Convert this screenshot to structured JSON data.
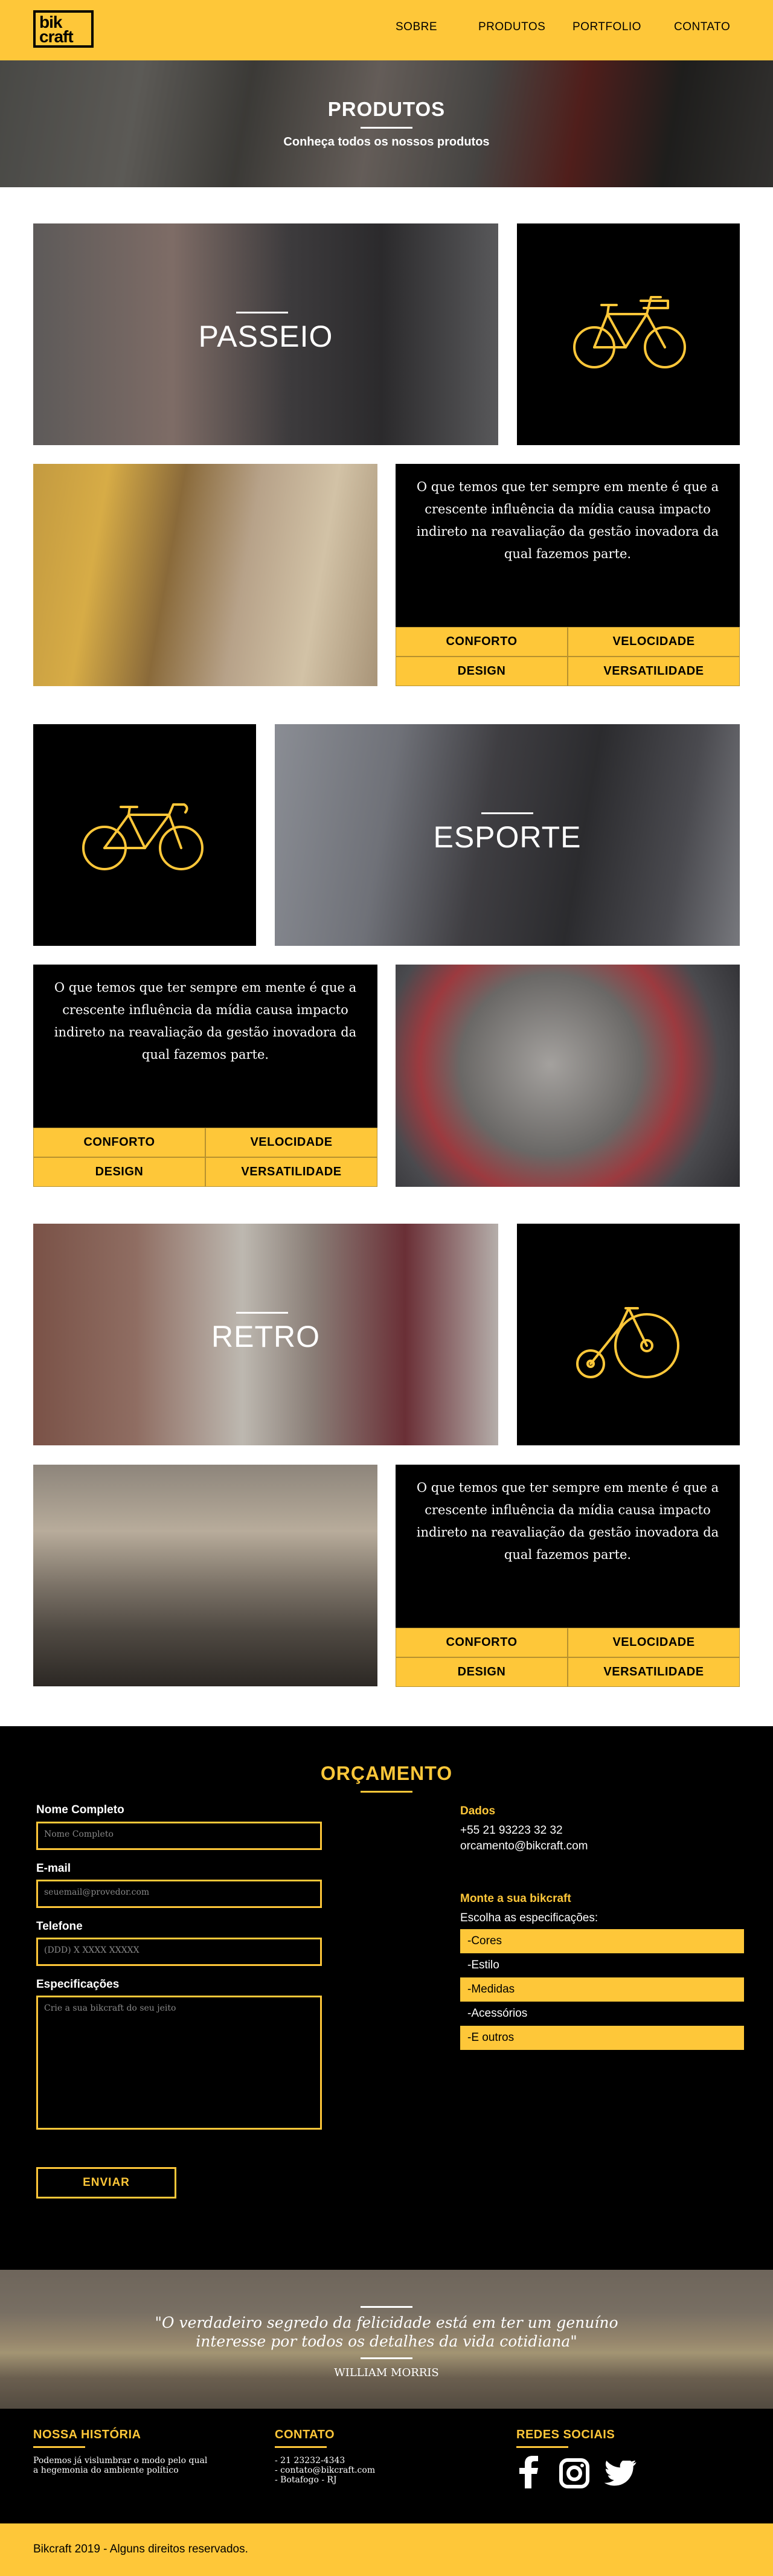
{
  "header": {
    "logo_line1": "bik",
    "logo_line2": "craft",
    "nav": [
      {
        "label": "SOBRE"
      },
      {
        "label": "PRODUTOS"
      },
      {
        "label": "PORTFOLIO"
      },
      {
        "label": "CONTATO"
      }
    ]
  },
  "hero": {
    "title": "PRODUTOS",
    "subtitle": "Conheça todos os nossos produtos"
  },
  "products": [
    {
      "name": "PASSEIO",
      "icon": "city-bicycle-icon",
      "description": "O que temos que ter sempre em mente é que a crescente influência da mídia causa impacto indireto na reavaliação da gestão inovadora da qual fazemos parte.",
      "features": [
        "CONFORTO",
        "VELOCIDADE",
        "DESIGN",
        "VERSATILIDADE"
      ]
    },
    {
      "name": "ESPORTE",
      "icon": "sport-bicycle-icon",
      "description": "O que temos que ter sempre em mente é que a crescente influência da mídia causa impacto indireto na reavaliação da gestão inovadora da qual fazemos parte.",
      "features": [
        "CONFORTO",
        "VELOCIDADE",
        "DESIGN",
        "VERSATILIDADE"
      ]
    },
    {
      "name": "RETRO",
      "icon": "penny-farthing-icon",
      "description": "O que temos que ter sempre em mente é que a crescente influência da mídia causa impacto indireto na reavaliação da gestão inovadora da qual fazemos parte.",
      "features": [
        "CONFORTO",
        "VELOCIDADE",
        "DESIGN",
        "VERSATILIDADE"
      ]
    }
  ],
  "orcamento": {
    "title": "ORÇAMENTO",
    "fields": {
      "name_label": "Nome Completo",
      "name_placeholder": "Nome Completo",
      "email_label": "E-mail",
      "email_placeholder": "seuemail@provedor.com",
      "phone_label": "Telefone",
      "phone_placeholder": "(DDD) X XXXX XXXXX",
      "spec_label": "Especificações",
      "spec_placeholder": "Crie a sua bikcraft do seu jeito",
      "submit": "ENVIAR"
    },
    "dados": {
      "title": "Dados",
      "phone": "+55 21 93223 32 32",
      "email": "orcamento@bikcraft.com"
    },
    "monte": {
      "title": "Monte a sua bikcraft",
      "intro": "Escolha as especificações:",
      "options": [
        "-Cores",
        "-Estilo",
        "-Medidas",
        "-Acessórios",
        "-E outros"
      ]
    }
  },
  "quote": {
    "line1": "\"O verdadeiro segredo da felicidade está em ter um genuíno",
    "line2": "interesse por todos os detalhes da vida cotidiana\"",
    "author": "WILLIAM MORRIS"
  },
  "footer": {
    "historia_title": "NOSSA HISTÓRIA",
    "historia_line1": "Podemos já vislumbrar o modo pelo qual",
    "historia_line2": "a hegemonia do ambiente político",
    "contato_title": "CONTATO",
    "contato_phone": "- 21 23232-4343",
    "contato_email": "- contato@bikcraft.com",
    "contato_place": "- Botafogo - RJ",
    "redes_title": "REDES SOCIAIS",
    "icons": [
      "facebook-icon",
      "instagram-icon",
      "twitter-icon"
    ]
  },
  "copyright": "Bikcraft 2019 - Alguns direitos reservados.",
  "colors": {
    "brand_yellow": "#fec739",
    "black": "#000000"
  }
}
